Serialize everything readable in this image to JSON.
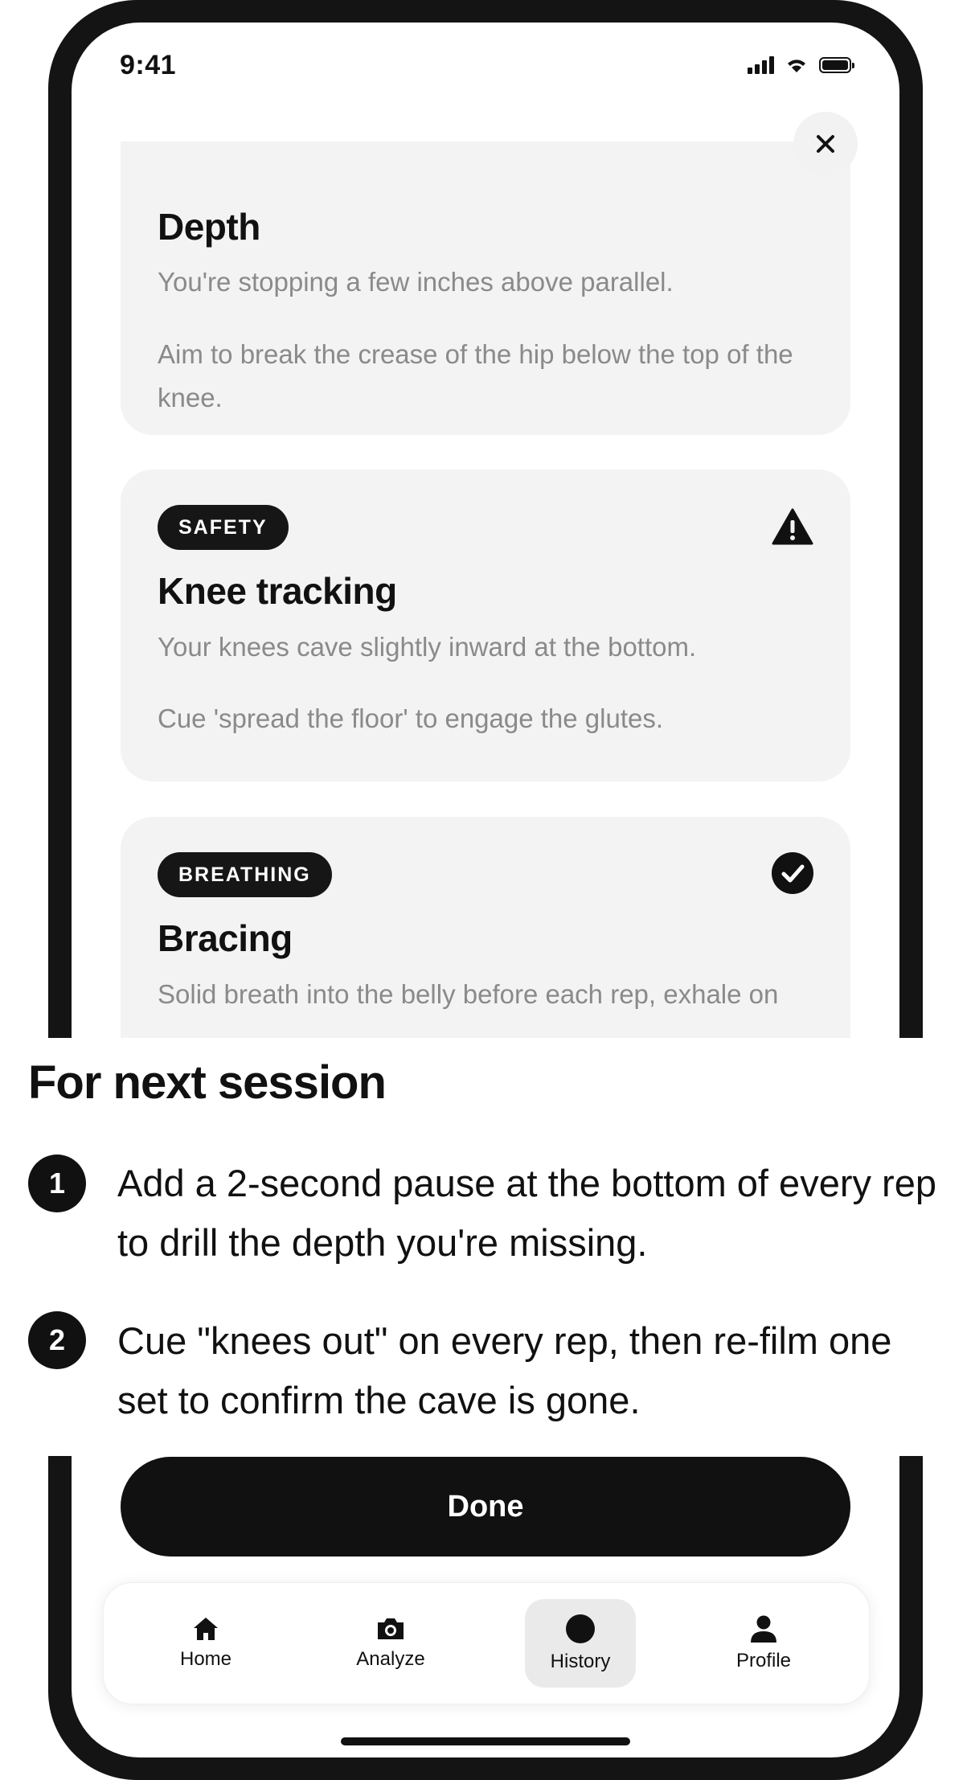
{
  "status_bar": {
    "time": "9:41"
  },
  "cards": [
    {
      "title": "Depth",
      "texts": [
        "You're stopping a few inches above parallel.",
        "Aim to break the crease of the hip below the top of the knee."
      ]
    },
    {
      "tag": "SAFETY",
      "icon": "warning-icon",
      "title": "Knee tracking",
      "texts": [
        "Your knees cave slightly inward at the bottom.",
        "Cue 'spread the floor' to engage the glutes."
      ]
    },
    {
      "tag": "BREATHING",
      "icon": "check-circle-icon",
      "title": "Bracing",
      "texts": [
        "Solid breath into the belly before each rep, exhale on"
      ]
    }
  ],
  "next_session": {
    "title": "For next session",
    "steps": [
      {
        "number": "1",
        "text": "Add a 2-second pause at the bottom of every rep to drill the depth you're missing."
      },
      {
        "number": "2",
        "text": "Cue \"knees out\" on every rep, then re-film one set to confirm the cave is gone."
      }
    ]
  },
  "done_label": "Done",
  "tabs": [
    {
      "label": "Home",
      "icon": "home-icon"
    },
    {
      "label": "Analyze",
      "icon": "camera-icon"
    },
    {
      "label": "History",
      "icon": "circle-icon",
      "active": true
    },
    {
      "label": "Profile",
      "icon": "person-icon"
    }
  ],
  "colors": {
    "accent": "#111111",
    "card_bg": "#f3f3f3",
    "muted_text": "#8a8a8a"
  }
}
